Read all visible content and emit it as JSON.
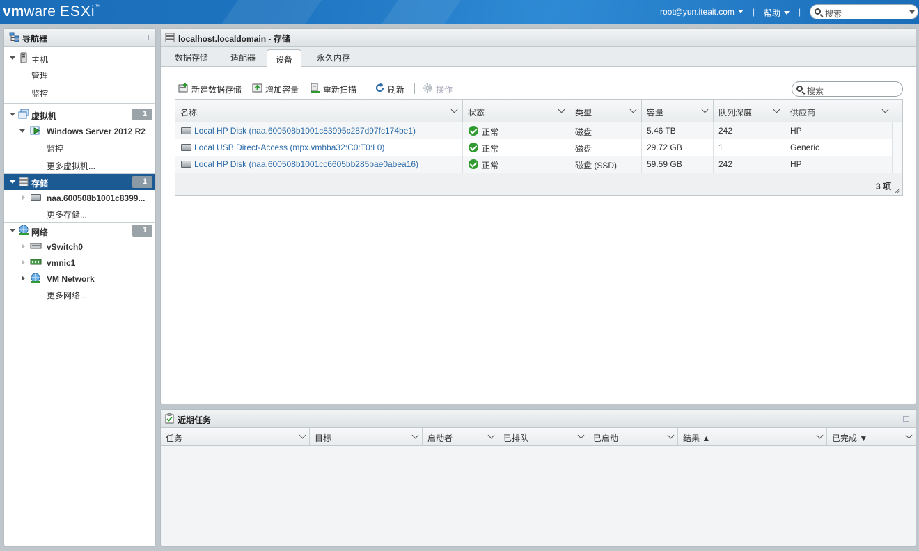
{
  "app": {
    "brand_vm": "vm",
    "brand_ware": "ware",
    "brand_product": "ESXi",
    "brand_tm": "™"
  },
  "header": {
    "user": "root@yun.iteait.com",
    "help": "帮助",
    "separator": "|",
    "search_placeholder": "搜索"
  },
  "navigator": {
    "title": "导航器",
    "host": {
      "label": "主机",
      "children": [
        "管理",
        "监控"
      ]
    },
    "vms": {
      "label": "虚拟机",
      "count": "1",
      "vm": "Windows Server 2012 R2",
      "vm_children": [
        "监控"
      ],
      "more": "更多虚拟机..."
    },
    "storage": {
      "label": "存储",
      "count": "1",
      "item": "naa.600508b1001c8399...",
      "more": "更多存储..."
    },
    "network": {
      "label": "网络",
      "count": "1",
      "items": [
        "vSwitch0",
        "vmnic1",
        "VM Network"
      ],
      "more": "更多网络..."
    }
  },
  "main": {
    "title": "localhost.localdomain - 存储",
    "tabs": [
      "数据存储",
      "适配器",
      "设备",
      "永久内存"
    ],
    "active_tab": "设备",
    "toolbar": {
      "new_datastore": "新建数据存储",
      "increase_capacity": "增加容量",
      "rescan": "重新扫描",
      "refresh": "刷新",
      "actions": "操作"
    },
    "search_placeholder": "搜索",
    "columns": [
      "名称",
      "状态",
      "类型",
      "容量",
      "队列深度",
      "供应商"
    ],
    "rows": [
      {
        "name": "Local HP Disk (naa.600508b1001c83995c287d97fc174be1)",
        "status": "正常",
        "type": "磁盘",
        "capacity": "5.46 TB",
        "queue": "242",
        "vendor": "HP"
      },
      {
        "name": "Local USB Direct-Access (mpx.vmhba32:C0:T0:L0)",
        "status": "正常",
        "type": "磁盘",
        "capacity": "29.72 GB",
        "queue": "1",
        "vendor": "Generic"
      },
      {
        "name": "Local HP Disk (naa.600508b1001cc6605bb285bae0abea16)",
        "status": "正常",
        "type": "磁盘 (SSD)",
        "capacity": "59.59 GB",
        "queue": "242",
        "vendor": "HP"
      }
    ],
    "item_count": "3 项"
  },
  "tasks": {
    "title": "近期任务",
    "columns": [
      "任务",
      "目标",
      "启动者",
      "已排队",
      "已启动",
      "结果 ▲",
      "已完成 ▼"
    ]
  },
  "colors": {
    "topbar": "#1e74c0",
    "selection": "#1c5a94",
    "link": "#2c6ba8",
    "ok": "#2f9a2f"
  }
}
